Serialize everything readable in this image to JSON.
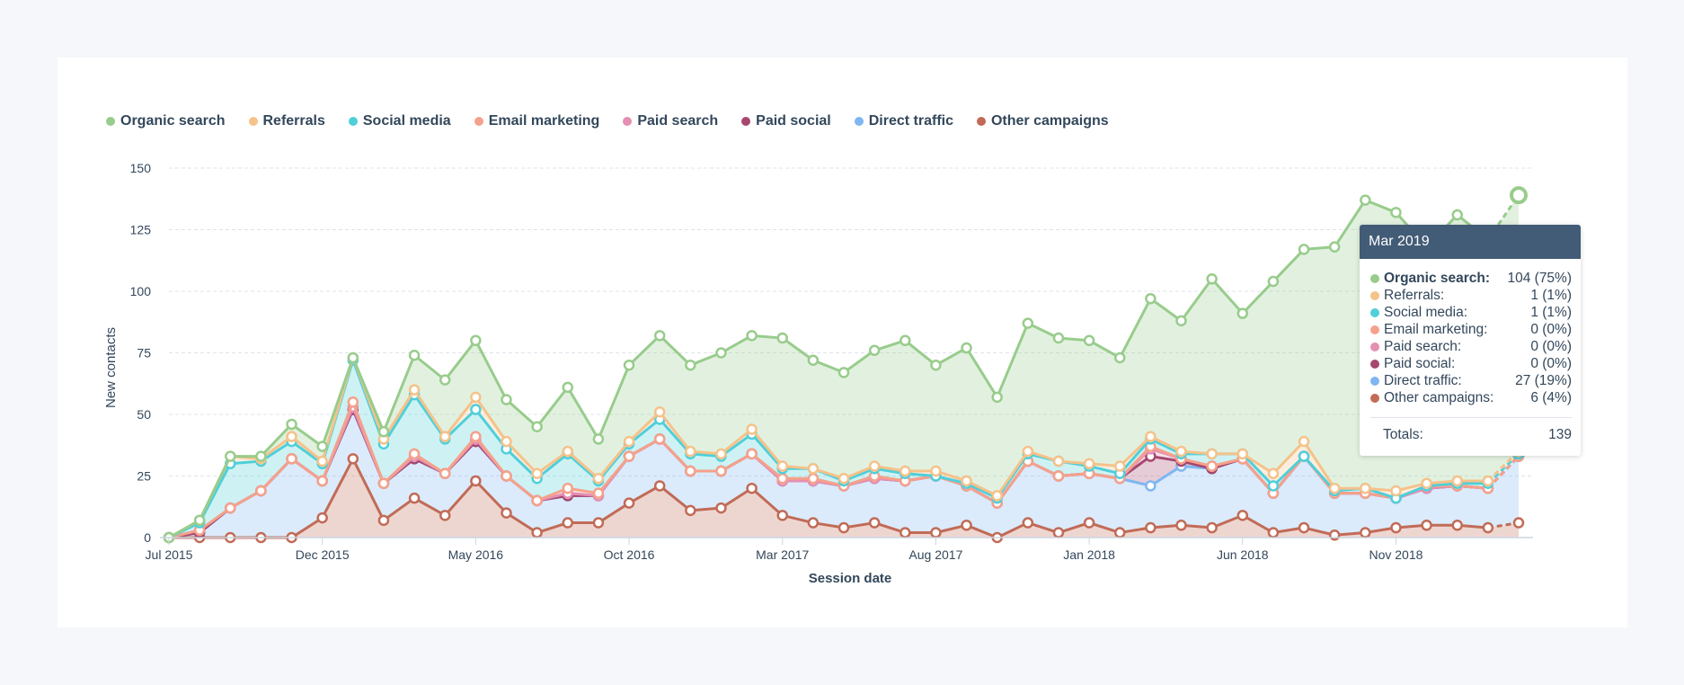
{
  "colors": {
    "organic": "#98cc8c",
    "referrals": "#f5c28a",
    "social": "#4fcfd9",
    "email": "#f5a18b",
    "paid_search": "#e58fb2",
    "paid_social": "#a5476f",
    "direct": "#7fb6f2",
    "other": "#c16b57"
  },
  "legend": [
    {
      "key": "organic",
      "label": "Organic search"
    },
    {
      "key": "referrals",
      "label": "Referrals"
    },
    {
      "key": "social",
      "label": "Social media"
    },
    {
      "key": "email",
      "label": "Email marketing"
    },
    {
      "key": "paid_search",
      "label": "Paid search"
    },
    {
      "key": "paid_social",
      "label": "Paid social"
    },
    {
      "key": "direct",
      "label": "Direct traffic"
    },
    {
      "key": "other",
      "label": "Other campaigns"
    }
  ],
  "tooltip": {
    "title": "Mar 2019",
    "rows": [
      {
        "key": "organic",
        "label": "Organic search:",
        "value": "104 (75%)",
        "bold": true
      },
      {
        "key": "referrals",
        "label": "Referrals:",
        "value": "1 (1%)"
      },
      {
        "key": "social",
        "label": "Social media:",
        "value": "1 (1%)"
      },
      {
        "key": "email",
        "label": "Email marketing:",
        "value": "0 (0%)"
      },
      {
        "key": "paid_search",
        "label": "Paid search:",
        "value": "0 (0%)"
      },
      {
        "key": "paid_social",
        "label": "Paid social:",
        "value": "0 (0%)"
      },
      {
        "key": "direct",
        "label": "Direct traffic:",
        "value": "27 (19%)"
      },
      {
        "key": "other",
        "label": "Other campaigns:",
        "value": "6 (4%)"
      }
    ],
    "totals_label": "Totals:",
    "totals_value": "139"
  },
  "chart_data": {
    "type": "area",
    "stacked": true,
    "title": "",
    "xlabel": "Session date",
    "ylabel": "New contacts",
    "ylim": [
      0,
      150
    ],
    "yticks": [
      0,
      25,
      50,
      75,
      100,
      125,
      150
    ],
    "grid": true,
    "legend_position": "top-left",
    "x_tick_labels": [
      {
        "index": 0,
        "label": "Jul 2015"
      },
      {
        "index": 5,
        "label": "Dec 2015"
      },
      {
        "index": 10,
        "label": "May 2016"
      },
      {
        "index": 15,
        "label": "Oct 2016"
      },
      {
        "index": 20,
        "label": "Mar 2017"
      },
      {
        "index": 25,
        "label": "Aug 2017"
      },
      {
        "index": 30,
        "label": "Jan 2018"
      },
      {
        "index": 35,
        "label": "Jun 2018"
      },
      {
        "index": 40,
        "label": "Nov 2018"
      }
    ],
    "x": [
      "Jul 2015",
      "Aug 2015",
      "Sep 2015",
      "Oct 2015",
      "Nov 2015",
      "Dec 2015",
      "Jan 2016",
      "Feb 2016",
      "Mar 2016",
      "Apr 2016",
      "May 2016",
      "Jun 2016",
      "Jul 2016",
      "Aug 2016",
      "Sep 2016",
      "Oct 2016",
      "Nov 2016",
      "Dec 2016",
      "Jan 2017",
      "Feb 2017",
      "Mar 2017",
      "Apr 2017",
      "May 2017",
      "Jun 2017",
      "Jul 2017",
      "Aug 2017",
      "Sep 2017",
      "Oct 2017",
      "Nov 2017",
      "Dec 2017",
      "Jan 2018",
      "Feb 2018",
      "Mar 2018",
      "Apr 2018",
      "May 2018",
      "Jun 2018",
      "Jul 2018",
      "Aug 2018",
      "Sep 2018",
      "Oct 2018",
      "Nov 2018",
      "Dec 2018",
      "Jan 2019",
      "Feb 2019",
      "Mar 2019"
    ],
    "series": [
      {
        "key": "other",
        "name": "Other campaigns",
        "values": [
          0,
          0,
          0,
          0,
          0,
          8,
          32,
          7,
          16,
          9,
          23,
          10,
          2,
          6,
          6,
          14,
          21,
          11,
          12,
          20,
          9,
          6,
          4,
          6,
          2,
          2,
          5,
          0,
          6,
          2,
          6,
          2,
          4,
          5,
          4,
          9,
          2,
          4,
          1,
          2,
          4,
          5,
          5,
          4,
          6
        ]
      },
      {
        "key": "direct",
        "name": "Direct traffic",
        "values": [
          0,
          2,
          12,
          19,
          32,
          15,
          20,
          15,
          16,
          17,
          16,
          15,
          13,
          11,
          11,
          19,
          19,
          16,
          15,
          14,
          14,
          17,
          17,
          18,
          21,
          23,
          16,
          14,
          25,
          23,
          20,
          22,
          17,
          24,
          24,
          23,
          16,
          29,
          17,
          16,
          12,
          15,
          16,
          16,
          27
        ]
      },
      {
        "key": "paid_social",
        "name": "Paid social",
        "values": [
          0,
          0,
          0,
          0,
          0,
          0,
          0,
          0,
          0,
          0,
          0,
          0,
          0,
          0,
          0,
          0,
          0,
          0,
          0,
          0,
          0,
          0,
          0,
          0,
          0,
          0,
          0,
          0,
          0,
          0,
          0,
          0,
          12,
          2,
          0,
          0,
          0,
          0,
          0,
          0,
          0,
          0,
          0,
          0,
          0
        ]
      },
      {
        "key": "paid_search",
        "name": "Paid search",
        "values": [
          0,
          1,
          0,
          0,
          0,
          0,
          1,
          0,
          1,
          0,
          1,
          0,
          0,
          1,
          0,
          0,
          0,
          0,
          0,
          0,
          0,
          0,
          0,
          0,
          0,
          0,
          0,
          0,
          0,
          0,
          0,
          0,
          3,
          1,
          1,
          0,
          0,
          0,
          0,
          0,
          0,
          0,
          0,
          0,
          0
        ]
      },
      {
        "key": "email",
        "name": "Email marketing",
        "values": [
          0,
          0,
          0,
          0,
          0,
          0,
          2,
          0,
          1,
          0,
          1,
          0,
          0,
          2,
          1,
          0,
          0,
          0,
          0,
          0,
          1,
          1,
          0,
          1,
          0,
          0,
          0,
          0,
          0,
          0,
          0,
          0,
          1,
          0,
          0,
          0,
          0,
          0,
          0,
          0,
          0,
          1,
          0,
          0,
          0
        ]
      },
      {
        "key": "social",
        "name": "Social media",
        "values": [
          0,
          3,
          18,
          12,
          7,
          7,
          17,
          16,
          24,
          14,
          11,
          11,
          9,
          14,
          5,
          5,
          8,
          7,
          6,
          8,
          4,
          4,
          2,
          3,
          3,
          0,
          1,
          2,
          3,
          6,
          3,
          2,
          3,
          2,
          5,
          2,
          3,
          0,
          1,
          2,
          0,
          0,
          1,
          2,
          1
        ]
      },
      {
        "key": "referrals",
        "name": "Referrals",
        "values": [
          0,
          1,
          3,
          1,
          2,
          1,
          1,
          2,
          2,
          1,
          5,
          3,
          2,
          1,
          1,
          1,
          3,
          1,
          1,
          2,
          1,
          0,
          1,
          1,
          1,
          2,
          1,
          1,
          1,
          0,
          1,
          3,
          1,
          1,
          0,
          0,
          5,
          6,
          1,
          0,
          3,
          1,
          1,
          1,
          1
        ]
      },
      {
        "key": "organic",
        "name": "Organic search",
        "values": [
          0,
          0,
          0,
          1,
          5,
          6,
          0,
          3,
          14,
          23,
          23,
          17,
          19,
          26,
          16,
          31,
          31,
          35,
          41,
          38,
          52,
          44,
          43,
          47,
          53,
          43,
          54,
          40,
          52,
          50,
          50,
          44,
          56,
          53,
          71,
          57,
          78,
          78,
          98,
          117,
          113,
          96,
          108,
          98,
          104
        ]
      }
    ]
  }
}
